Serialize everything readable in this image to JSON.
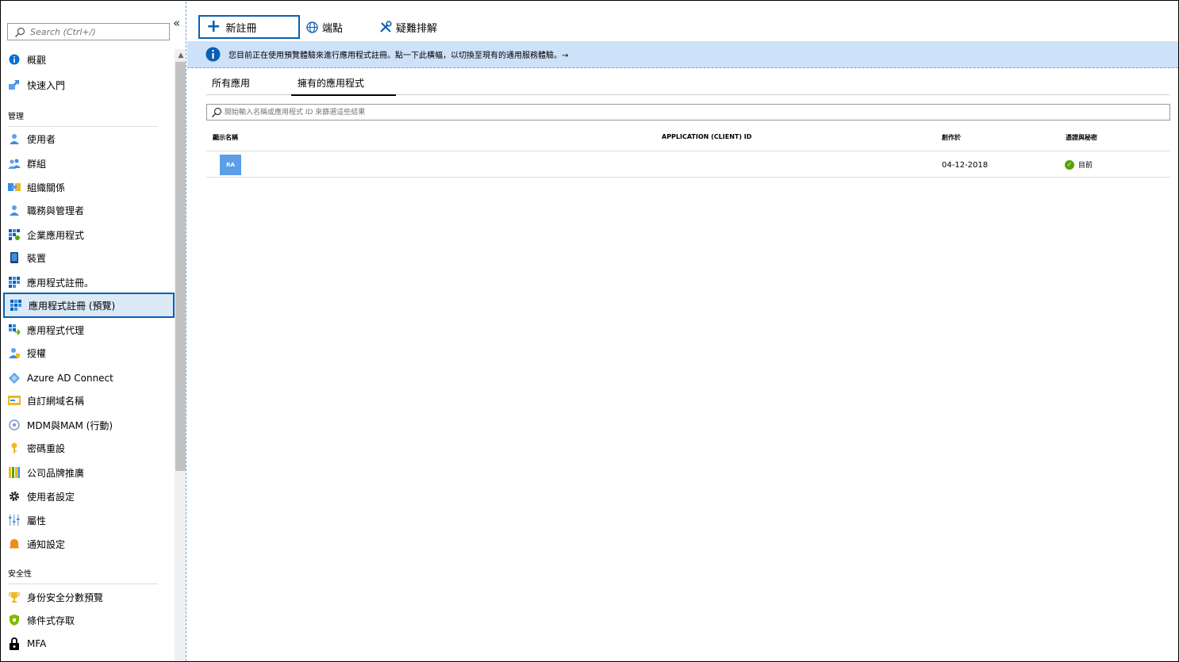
{
  "sidebar": {
    "search_placeholder": "Search (Ctrl+/)",
    "collapse_label": "«",
    "top_items": [
      {
        "label": "概觀",
        "icon": "info-icon"
      },
      {
        "label": "快速入門",
        "icon": "quickstart-icon"
      }
    ],
    "section_manage": "管理",
    "manage_items": [
      {
        "label": "使用者",
        "icon": "user-icon"
      },
      {
        "label": "群組",
        "icon": "group-icon"
      },
      {
        "label": "組織關係",
        "icon": "org-relationship-icon"
      },
      {
        "label": "職務與管理者",
        "icon": "roles-icon"
      },
      {
        "label": "企業應用程式",
        "icon": "enterprise-apps-icon"
      },
      {
        "label": "裝置",
        "icon": "device-icon"
      },
      {
        "label": "應用程式註冊。",
        "icon": "app-registrations-icon"
      },
      {
        "label": "應用程式註冊 (預覽)",
        "icon": "app-registrations-preview-icon"
      },
      {
        "label": "應用程式代理",
        "icon": "app-proxy-icon"
      },
      {
        "label": "授權",
        "icon": "licenses-icon"
      },
      {
        "label": "Azure AD Connect",
        "icon": "azure-ad-connect-icon"
      },
      {
        "label": "自訂網域名稱",
        "icon": "custom-domain-icon"
      },
      {
        "label": "MDM與MAM (行動)",
        "icon": "mobility-icon"
      },
      {
        "label": "密碼重設",
        "icon": "password-reset-icon"
      },
      {
        "label": "公司品牌推廣",
        "icon": "branding-icon"
      },
      {
        "label": "使用者設定",
        "icon": "gear-icon"
      },
      {
        "label": "屬性",
        "icon": "properties-icon"
      },
      {
        "label": "通知設定",
        "icon": "bell-icon"
      }
    ],
    "section_security": "安全性",
    "security_items": [
      {
        "label": "身份安全分數預覽",
        "icon": "trophy-icon"
      },
      {
        "label": "條件式存取",
        "icon": "shield-icon"
      },
      {
        "label": "MFA",
        "icon": "lock-icon"
      }
    ]
  },
  "toolbar": {
    "new_registration": "新註冊",
    "endpoints": "端點",
    "troubleshooting": "疑難排解"
  },
  "banner": {
    "text": "您目前正在使用預覽體驗來進行應用程式註冊。點一下此橫幅，以切換至現有的通用服務體驗。→"
  },
  "tabs": {
    "all": "所有應用",
    "owned": "擁有的應用程式"
  },
  "filter": {
    "placeholder": "開始輸入名稱或應用程式 ID 來篩選這些結果"
  },
  "table": {
    "headers": {
      "display_name": "顯示名稱",
      "client_id": "APPLICATION (CLIENT) ID",
      "created": "創作於",
      "certs": "憑證與秘密"
    },
    "rows": [
      {
        "avatar": "RA",
        "created": "04-12-2018",
        "status": "目前"
      }
    ]
  },
  "colors": {
    "accent": "#0a5fb4",
    "banner_bg": "#cde1f9",
    "avatar_bg": "#5c9ee8",
    "status_ok": "#57a300"
  }
}
